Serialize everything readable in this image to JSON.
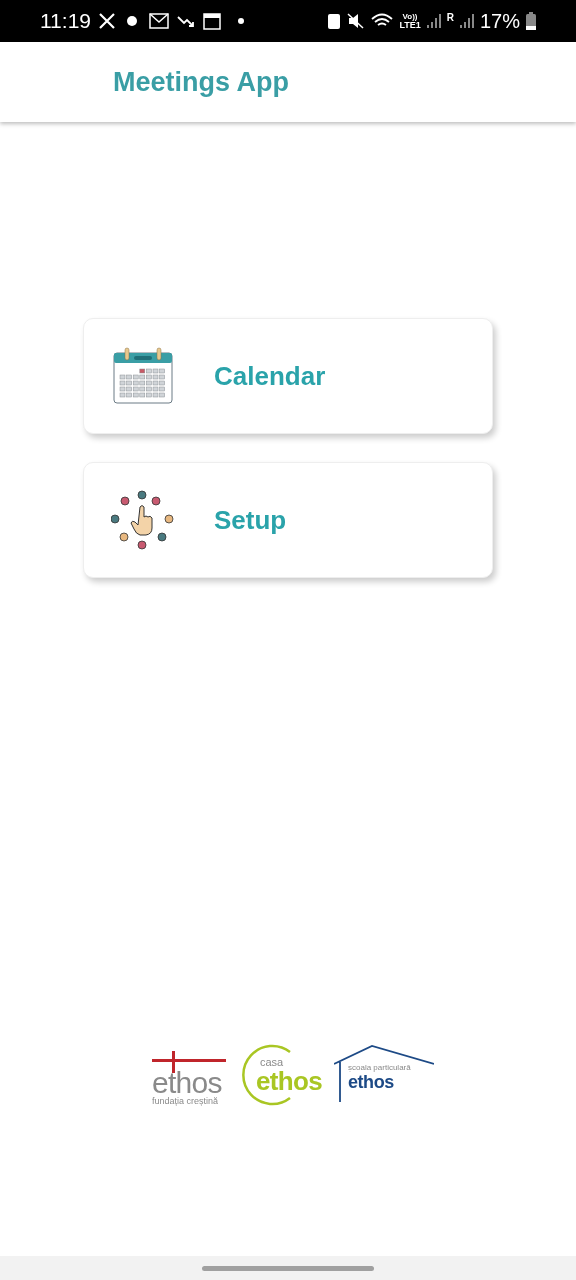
{
  "status_bar": {
    "time": "11:19",
    "network": "Vo))",
    "network_sub": "LTE1",
    "roaming": "R",
    "battery": "17%"
  },
  "app_bar": {
    "title": "Meetings App"
  },
  "menu": [
    {
      "kind": "calendar",
      "label": "Calendar"
    },
    {
      "kind": "setup",
      "label": "Setup"
    }
  ],
  "logos": [
    {
      "kind": "cross",
      "name": "ethos",
      "caption": "fundația creștină"
    },
    {
      "kind": "circle",
      "prefix": "casa",
      "name": "ethos"
    },
    {
      "kind": "house",
      "caption": "școala particulară",
      "name": "ethos"
    }
  ]
}
